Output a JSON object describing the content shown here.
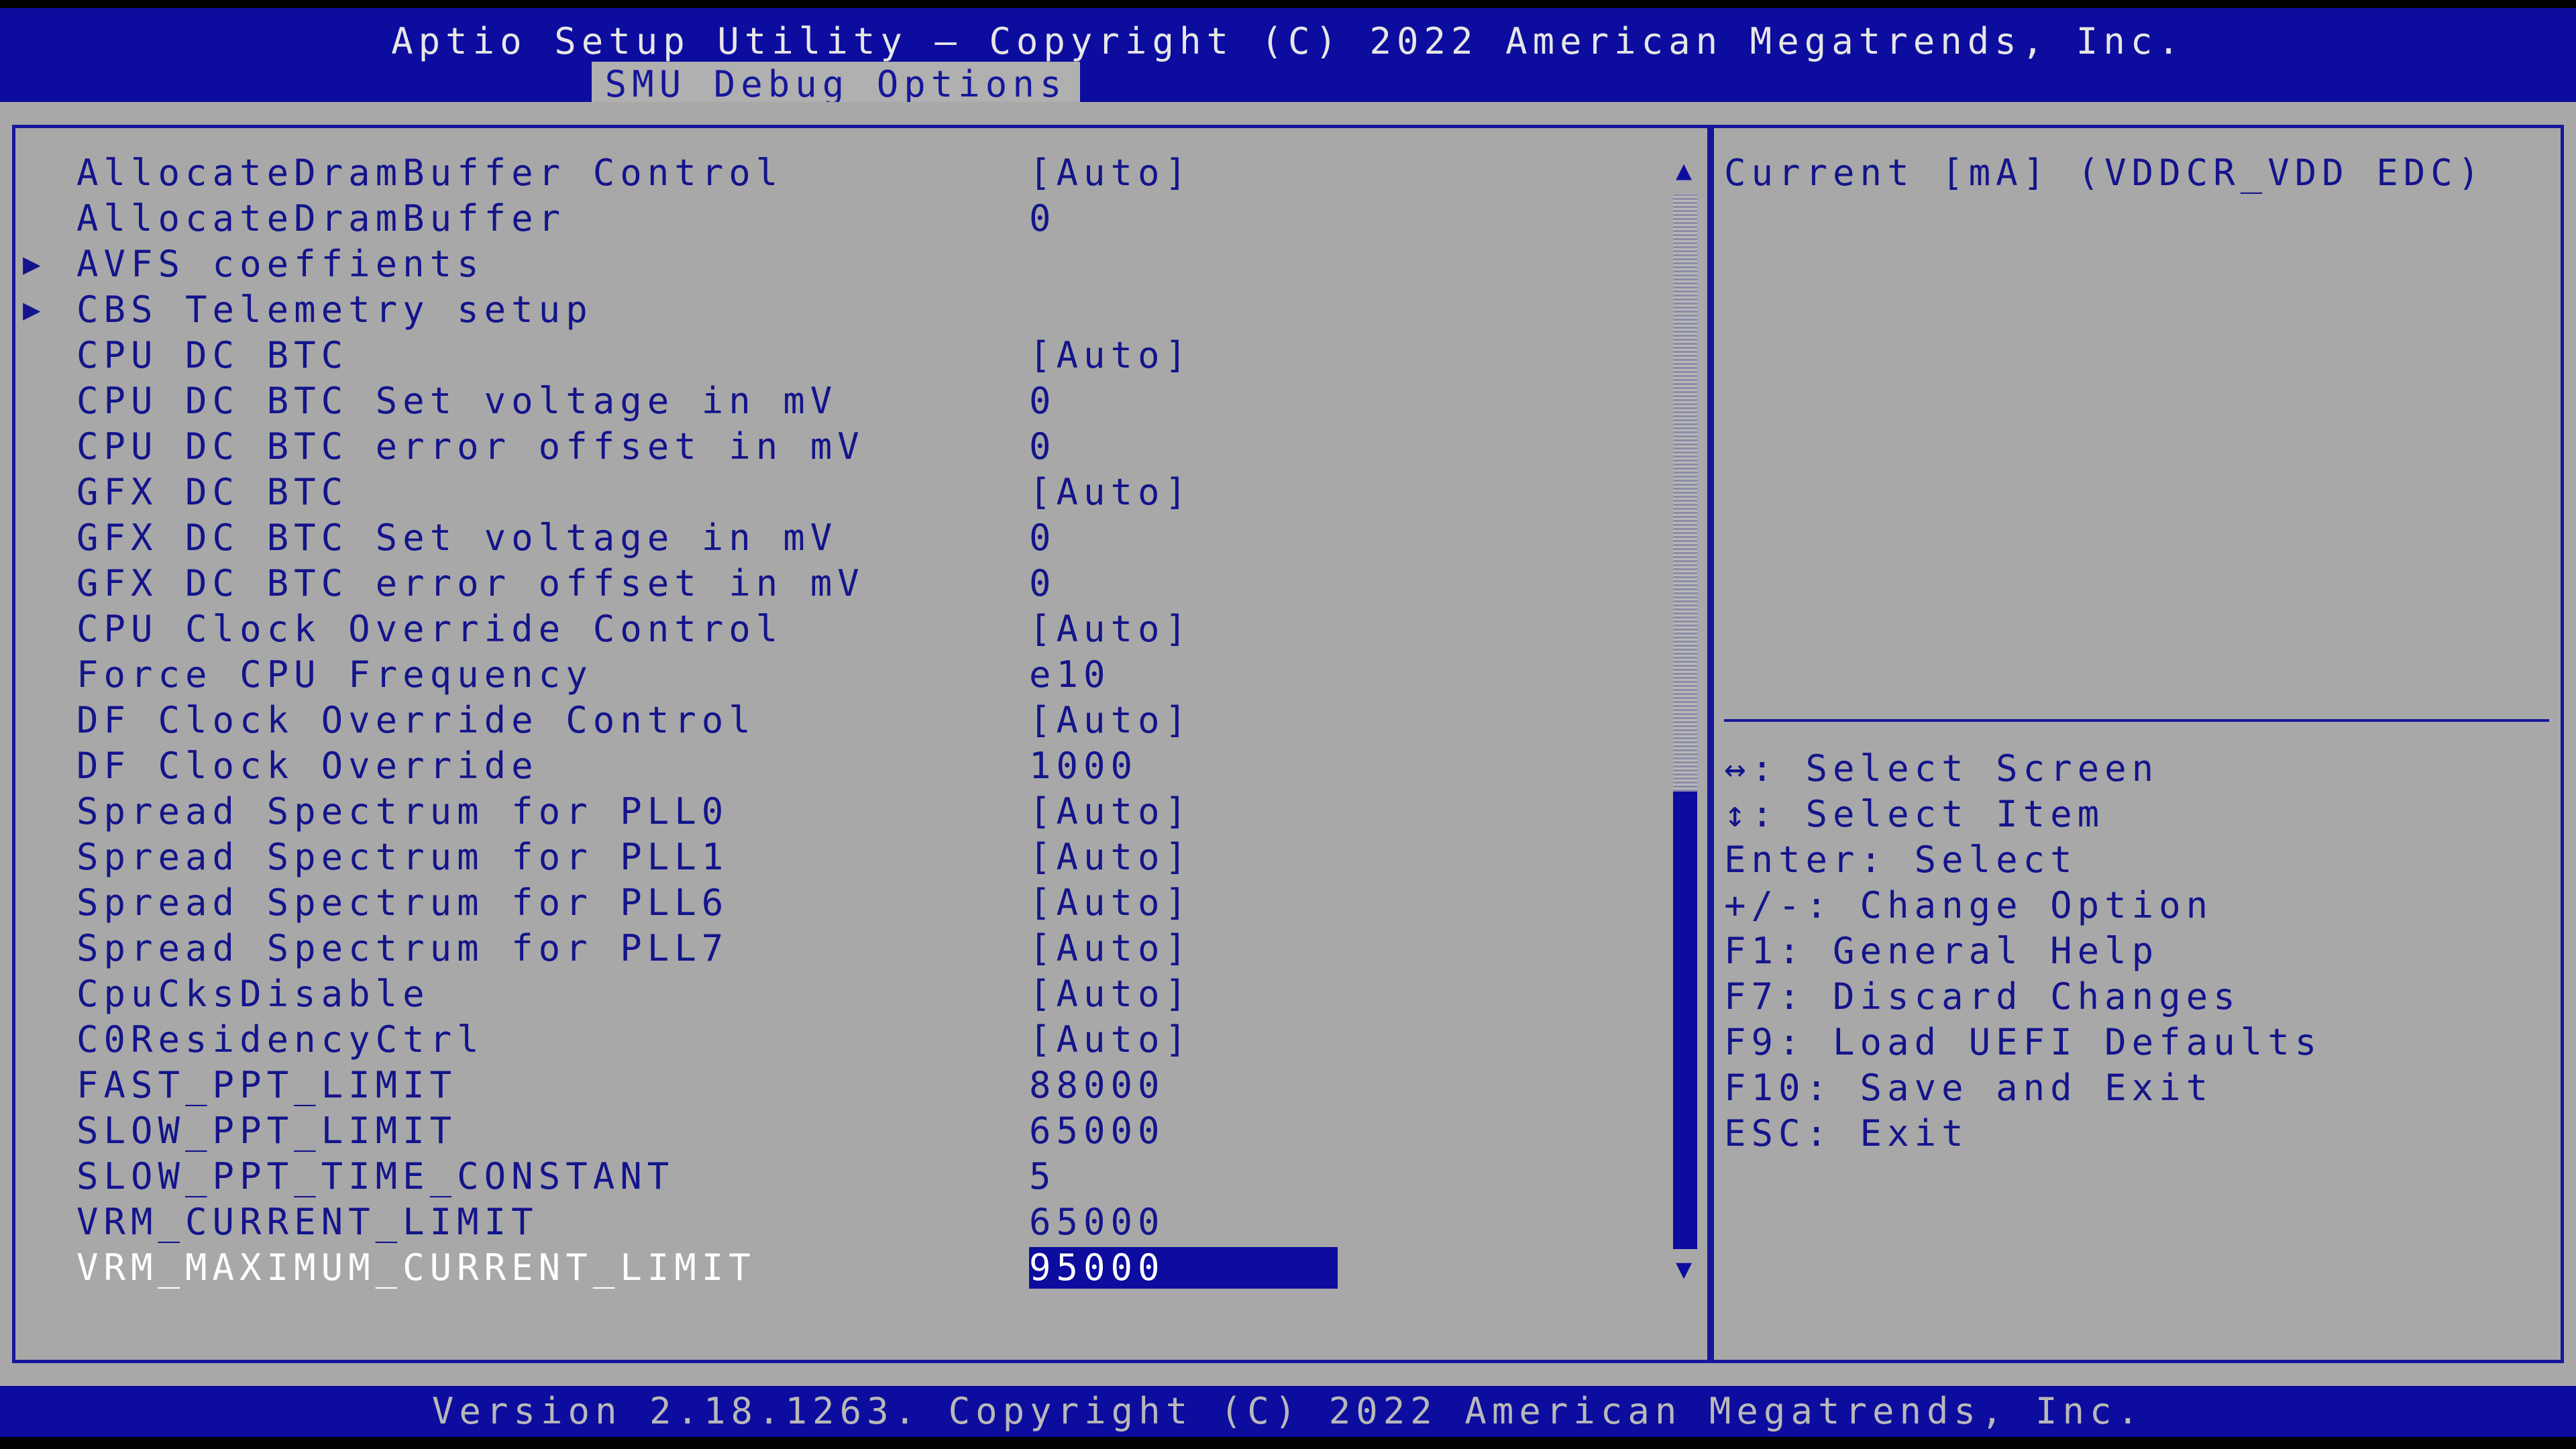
{
  "header": {
    "title": "Aptio Setup Utility – Copyright (C) 2022 American Megatrends, Inc.",
    "tab": "SMU Debug Options"
  },
  "settings": [
    {
      "label": "AllocateDramBuffer Control",
      "value": "[Auto]",
      "submenu": false
    },
    {
      "label": "AllocateDramBuffer",
      "value": "0",
      "submenu": false
    },
    {
      "label": "AVFS coeffients",
      "value": "",
      "submenu": true
    },
    {
      "label": "CBS Telemetry setup",
      "value": "",
      "submenu": true
    },
    {
      "label": "CPU DC BTC",
      "value": "[Auto]",
      "submenu": false
    },
    {
      "label": "CPU DC BTC Set voltage in mV",
      "value": "0",
      "submenu": false
    },
    {
      "label": "CPU DC BTC error offset in mV",
      "value": "0",
      "submenu": false
    },
    {
      "label": "GFX DC BTC",
      "value": "[Auto]",
      "submenu": false
    },
    {
      "label": "GFX DC BTC Set voltage in mV",
      "value": "0",
      "submenu": false
    },
    {
      "label": "GFX DC BTC error offset in mV",
      "value": "0",
      "submenu": false
    },
    {
      "label": "CPU Clock Override Control",
      "value": "[Auto]",
      "submenu": false
    },
    {
      "label": "Force CPU Frequency",
      "value": "e10",
      "submenu": false
    },
    {
      "label": "DF Clock Override Control",
      "value": "[Auto]",
      "submenu": false
    },
    {
      "label": "DF Clock Override",
      "value": "1000",
      "submenu": false
    },
    {
      "label": "Spread Spectrum for PLL0",
      "value": "[Auto]",
      "submenu": false
    },
    {
      "label": "Spread Spectrum for PLL1",
      "value": "[Auto]",
      "submenu": false
    },
    {
      "label": "Spread Spectrum for PLL6",
      "value": "[Auto]",
      "submenu": false
    },
    {
      "label": "Spread Spectrum for PLL7",
      "value": "[Auto]",
      "submenu": false
    },
    {
      "label": "CpuCksDisable",
      "value": "[Auto]",
      "submenu": false
    },
    {
      "label": "C0ResidencyCtrl",
      "value": "[Auto]",
      "submenu": false
    },
    {
      "label": "FAST_PPT_LIMIT",
      "value": "88000",
      "submenu": false
    },
    {
      "label": "SLOW_PPT_LIMIT",
      "value": "65000",
      "submenu": false
    },
    {
      "label": "SLOW_PPT_TIME_CONSTANT",
      "value": "5",
      "submenu": false
    },
    {
      "label": "VRM_CURRENT_LIMIT",
      "value": "65000",
      "submenu": false
    },
    {
      "label": "VRM_MAXIMUM_CURRENT_LIMIT",
      "value": "95000",
      "submenu": false,
      "selected": true
    }
  ],
  "submenu_marker": "▶",
  "scrollbar": {
    "up": "▲",
    "down": "▼"
  },
  "help": {
    "description": "Current [mA] (VDDCR_VDD EDC)",
    "keys": [
      "↔: Select Screen",
      "↕: Select Item",
      "Enter: Select",
      "+/-: Change Option",
      "F1: General Help",
      "F7: Discard Changes",
      "F9: Load UEFI Defaults",
      "F10: Save and Exit",
      "ESC: Exit"
    ]
  },
  "footer": "Version 2.18.1263. Copyright (C) 2022 American Megatrends, Inc.",
  "colors": {
    "blue": "#0c0c9e",
    "panel": "#a8a8a8",
    "text_blue": "#14148c"
  }
}
